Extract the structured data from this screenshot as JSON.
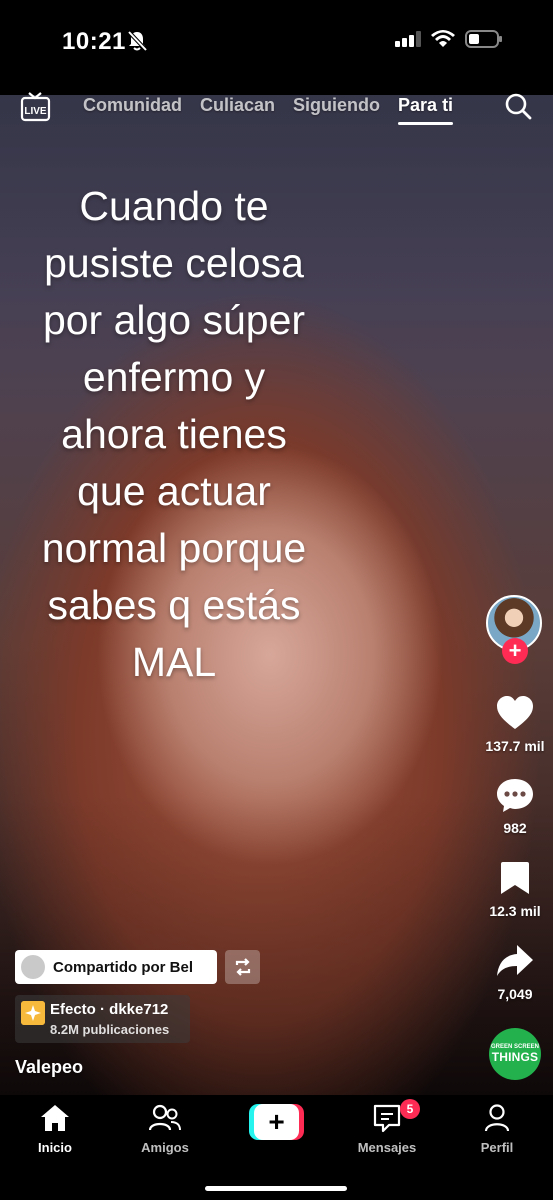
{
  "status_bar": {
    "time": "10:21",
    "icons": [
      "bell-slash-icon",
      "signal-icon",
      "wifi-icon",
      "battery-icon"
    ]
  },
  "top_nav": {
    "live_label": "LIVE",
    "tabs": [
      {
        "label": "Comunidad",
        "active": false
      },
      {
        "label": "Culiacan",
        "active": false
      },
      {
        "label": "Siguiendo",
        "active": false
      },
      {
        "label": "Para ti",
        "active": true
      }
    ],
    "search_icon": "search-icon"
  },
  "video": {
    "overlay_lines": [
      "Cuando te",
      "pusiste celosa",
      "por algo súper",
      "enfermo y",
      "ahora tienes",
      "que actuar",
      "normal porque",
      "sabes q estás",
      "MAL"
    ]
  },
  "right_rail": {
    "follow_label": "+",
    "likes": "137.7 mil",
    "comments": "982",
    "saves": "12.3 mil",
    "shares": "7,049"
  },
  "shared_by": {
    "label": "Compartido por Bel"
  },
  "effect": {
    "title": "Efecto · dkke712",
    "subtitle": "8.2M publicaciones"
  },
  "author": "Valepeo",
  "sound_disc": {
    "line1": "GREEN SCREEN",
    "line2": "THINGS"
  },
  "bottom_nav": {
    "items": [
      {
        "label": "Inicio",
        "active": true
      },
      {
        "label": "Amigos",
        "active": false
      },
      {
        "label": "Mensajes",
        "active": false,
        "badge": "5"
      },
      {
        "label": "Perfil",
        "active": false
      }
    ],
    "create_label": "+"
  },
  "colors": {
    "accent": "#fe2c55",
    "cyan": "#25f4ee",
    "sound_disc": "#22b14c"
  }
}
